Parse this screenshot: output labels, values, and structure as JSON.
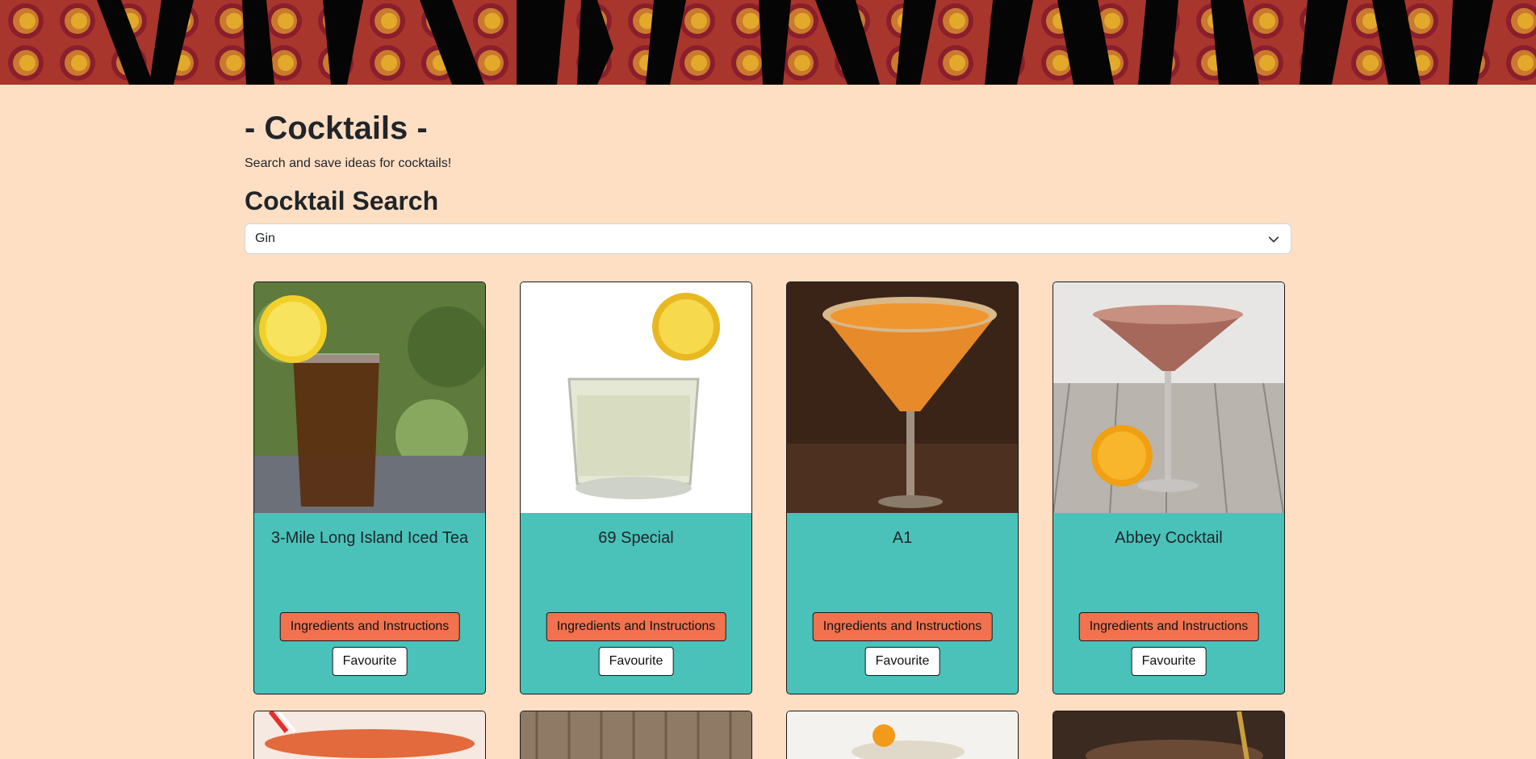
{
  "header": {
    "title": "- Cocktails -",
    "subtitle": "Search and save ideas for cocktails!"
  },
  "search": {
    "title": "Cocktail Search",
    "selected_ingredient": "Gin"
  },
  "cards": [
    {
      "name": "3-Mile Long Island Iced Tea",
      "info_label": "Ingredients and Instructions",
      "fav_label": "Favourite"
    },
    {
      "name": "69 Special",
      "info_label": "Ingredients and Instructions",
      "fav_label": "Favourite"
    },
    {
      "name": "A1",
      "info_label": "Ingredients and Instructions",
      "fav_label": "Favourite"
    },
    {
      "name": "Abbey Cocktail",
      "info_label": "Ingredients and Instructions",
      "fav_label": "Favourite"
    }
  ],
  "colors": {
    "page_background": "#ffdfc4",
    "card_body": "#4ac2ba",
    "info_button": "#f2714e",
    "banner_red": "#b23a2c",
    "banner_yellow": "#e0a526"
  }
}
